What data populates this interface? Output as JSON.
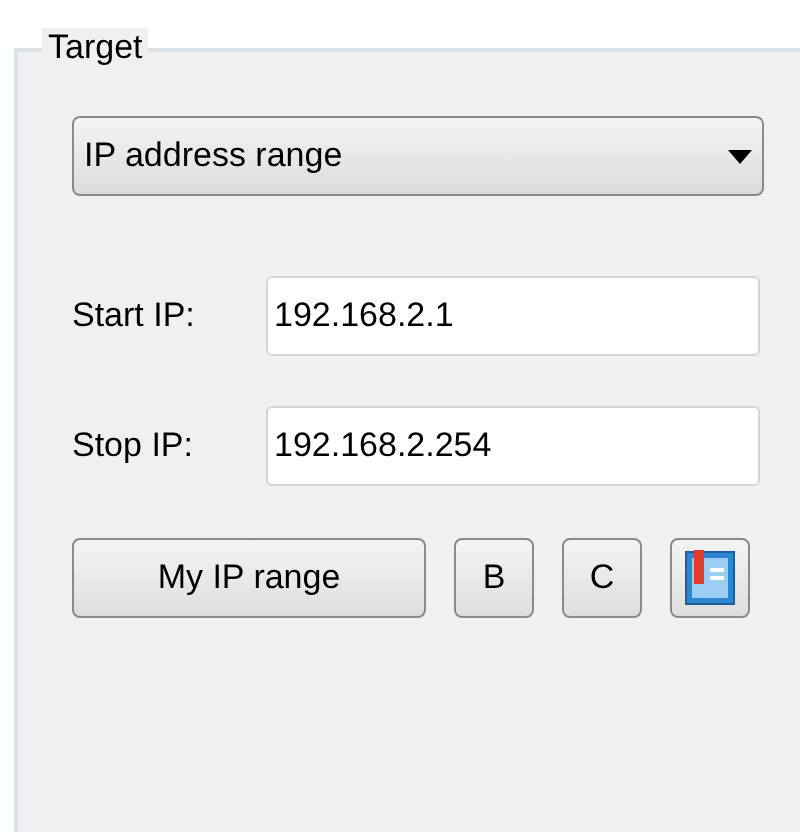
{
  "group": {
    "title": "Target"
  },
  "dropdown": {
    "value": "IP address range"
  },
  "fields": [
    {
      "label": "Start IP:",
      "value": "192.168.2.1"
    },
    {
      "label": "Stop IP:",
      "value": "192.168.2.254"
    }
  ],
  "buttons": [
    {
      "kind": "text",
      "label": "My IP range"
    },
    {
      "kind": "text",
      "label": "B"
    },
    {
      "kind": "text",
      "label": "C"
    },
    {
      "kind": "icon"
    }
  ]
}
